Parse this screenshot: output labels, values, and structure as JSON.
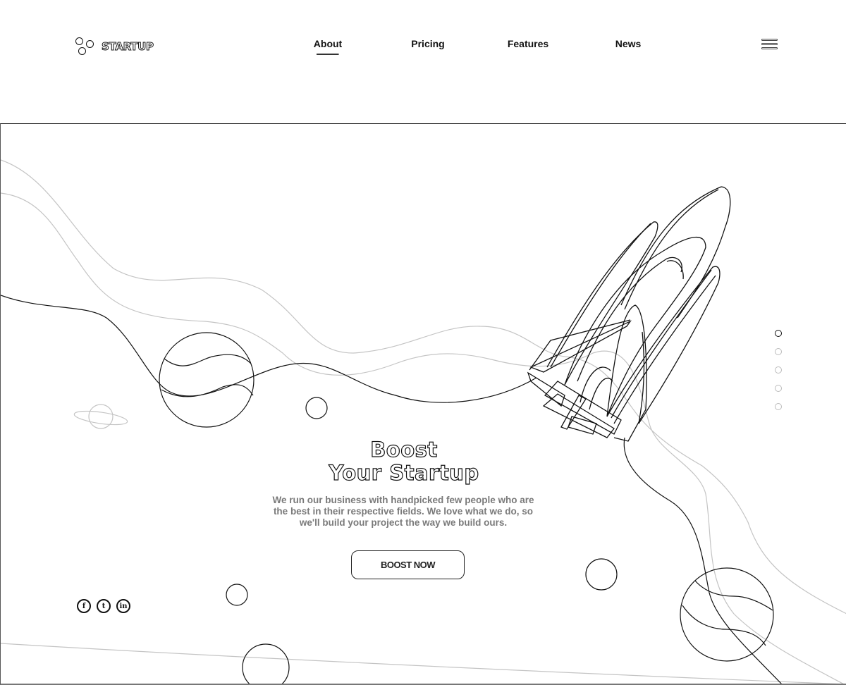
{
  "brand": {
    "name": "STARTUP",
    "logo_icon": "three-circles-logo-icon"
  },
  "nav": {
    "items": [
      {
        "label": "About",
        "active": true
      },
      {
        "label": "Pricing",
        "active": false
      },
      {
        "label": "Features",
        "active": false
      },
      {
        "label": "News",
        "active": false
      }
    ],
    "menu_icon": "hamburger-menu-icon"
  },
  "hero": {
    "headline_line1": "Boost",
    "headline_line2": "Your Startup",
    "description": "We run our business with handpicked few people who are the best in their respective fields. We love what we do, so we'll build your project the way we build ours.",
    "cta_label": "BOOST NOW",
    "illustration": "rocket-launch-line-art"
  },
  "social": [
    {
      "name": "facebook",
      "glyph": "f",
      "icon": "facebook-icon"
    },
    {
      "name": "twitter",
      "glyph": "t",
      "icon": "twitter-icon"
    },
    {
      "name": "linkedin",
      "glyph": "in",
      "icon": "linkedin-icon"
    }
  ],
  "slider": {
    "count": 5,
    "active_index": 0
  },
  "colors": {
    "line_dark": "#111111",
    "line_light": "#c4c4c4",
    "text_muted": "#7a7a7a",
    "background": "#ffffff"
  }
}
